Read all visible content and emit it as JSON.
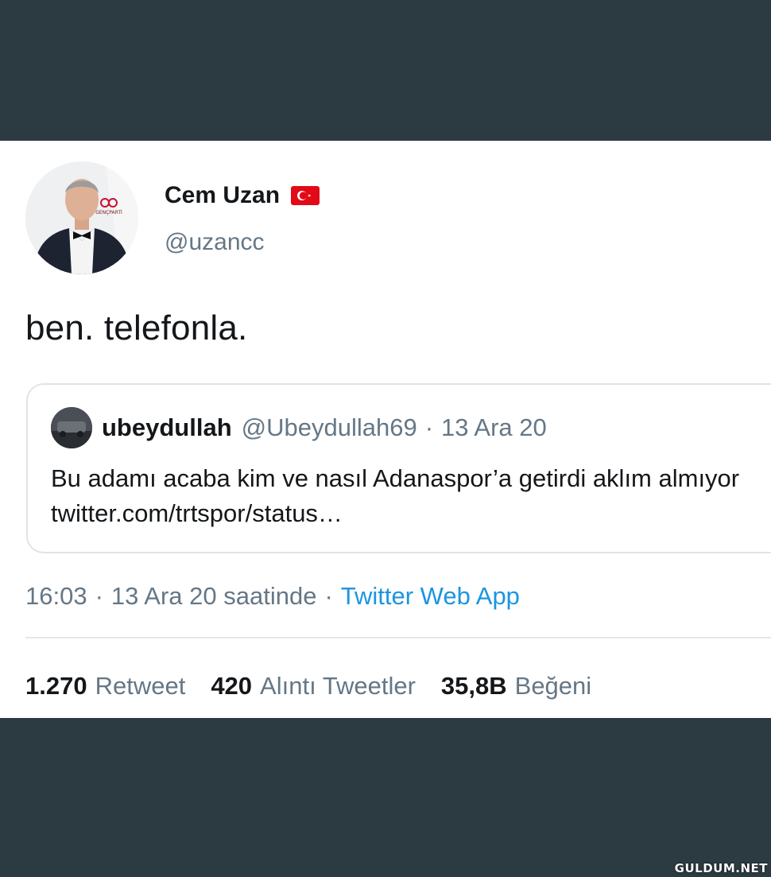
{
  "tweet": {
    "display_name": "Cem Uzan",
    "handle": "@uzancc",
    "flag_icon": "turkey-flag-icon",
    "text": "ben. telefonla.",
    "avatar_logo_text": "GENÇPARTİ",
    "time": "16:03",
    "date_text": "13 Ara 20 saatinde",
    "source": "Twitter Web App"
  },
  "quote": {
    "display_name": "ubeydullah",
    "handle": "@Ubeydullah69",
    "date": "13 Ara 20",
    "text": "Bu adamı acaba kim ve nasıl Adanaspor’a getirdi aklım almıyor twitter.com/trtspor/status…"
  },
  "stats": {
    "retweets_count": "1.270",
    "retweets_label": "Retweet",
    "quotes_count": "420",
    "quotes_label": "Alıntı Tweetler",
    "likes_count": "35,8B",
    "likes_label": "Beğeni"
  },
  "separator": "·",
  "watermark": "GULDUM.NET",
  "colors": {
    "background": "#2c3a42",
    "card": "#ffffff",
    "muted_text": "#657786",
    "link": "#1b95e0",
    "flag_red": "#e30a17"
  }
}
